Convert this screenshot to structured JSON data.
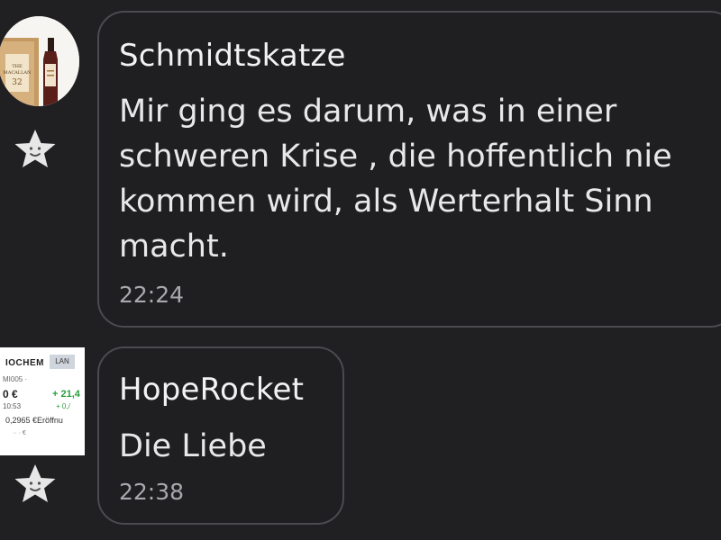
{
  "messages": [
    {
      "author": "Schmidtskatze",
      "text": "Mir ging es darum, was in einer\nschweren Krise , die hoffentlich nie\nkommen wird, als Werterhalt Sinn\nmacht.",
      "time": "22:24",
      "avatar": "whisky-bottle-avatar"
    },
    {
      "author": "HopeRocket",
      "text": "Die Liebe",
      "time": "22:38",
      "avatar": "stock-ticker-avatar"
    }
  ],
  "ticker_avatar": {
    "name": "IOCHEM",
    "tab": "LAN",
    "id": "MI005 ·",
    "price": "0 €",
    "change": "+ 21,4",
    "line2": "10:53",
    "change2": "+ 0,/",
    "line3": "0,2965 €Eröffnu",
    "line4": "·· · €"
  },
  "colors": {
    "background": "#202023",
    "bubble_border": "#4a4a4f",
    "time": "#a9a9ad",
    "positive": "#2b9c3a"
  }
}
